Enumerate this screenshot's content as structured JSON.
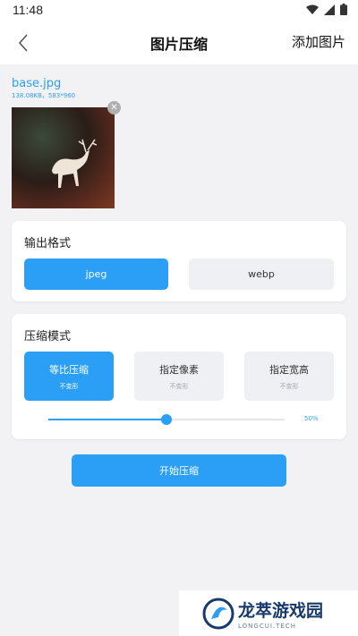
{
  "status": {
    "time": "11:48"
  },
  "header": {
    "title": "图片压缩",
    "action": "添加图片",
    "back_icon": "chevron-left-icon"
  },
  "file": {
    "name": "base.jpg",
    "meta": "138.08KB，583*960"
  },
  "format_card": {
    "title": "输出格式",
    "options": [
      {
        "label": "jpeg",
        "selected": true
      },
      {
        "label": "webp",
        "selected": false
      }
    ]
  },
  "mode_card": {
    "title": "压缩模式",
    "modes": [
      {
        "label": "等比压缩",
        "note": "不变形",
        "selected": true
      },
      {
        "label": "指定像素",
        "note": "不变形",
        "selected": false
      },
      {
        "label": "指定宽高",
        "note": "不变形",
        "selected": false
      }
    ],
    "slider": {
      "value": 0.5,
      "label": "50%"
    }
  },
  "start_button": "开始压缩",
  "watermark": {
    "cn": "龙萃游戏园",
    "en": "LONGCUI.TECH"
  },
  "colors": {
    "accent": "#2a9ff5",
    "background": "#f2f2f4",
    "inactive": "#eef0f4"
  }
}
